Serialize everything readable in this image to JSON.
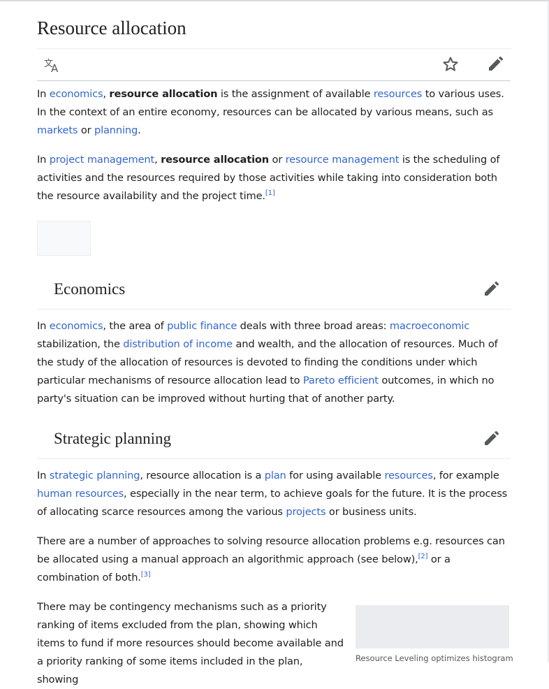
{
  "page": {
    "title": "Resource allocation",
    "actions": {
      "language_icon": "language-icon",
      "watch_icon": "star-icon",
      "edit_icon": "pencil-icon"
    }
  },
  "intro": {
    "p1": {
      "t1": "In ",
      "l1": "economics",
      "t2": ", ",
      "b1": "resource allocation",
      "t3": " is the assignment of available ",
      "l2": "resources",
      "t4": " to various uses. In the context of an entire economy, resources can be allocated by various means, such as ",
      "l3": "markets",
      "t5": " or ",
      "l4": "planning",
      "t6": "."
    },
    "p2": {
      "t1": "In ",
      "l1": "project management",
      "t2": ", ",
      "b1": "resource allocation",
      "t3": " or ",
      "l2": "resource management",
      "t4": " is the scheduling of activities and the resources required by those activities while taking into consideration both the resource availability and the project time.",
      "ref1": "[1]"
    }
  },
  "sections": [
    {
      "heading": "Economics",
      "edit_icon": "pencil-icon",
      "p1": {
        "t1": "In ",
        "l1": "economics",
        "t2": ", the area of ",
        "l2": "public finance",
        "t3": " deals with three broad areas: ",
        "l3": "macroeconomic",
        "t4": " stabilization, the ",
        "l4": "distribution of income",
        "t5": " and wealth, and the allocation of resources. Much of the study of the allocation of resources is devoted to finding the conditions under which particular mechanisms of resource allocation lead to ",
        "l5": "Pareto efficient",
        "t6": " outcomes, in which no party's situation can be improved without hurting that of another party."
      }
    },
    {
      "heading": "Strategic planning",
      "edit_icon": "pencil-icon",
      "p1": {
        "t1": "In ",
        "l1": "strategic planning",
        "t2": ", resource allocation is a ",
        "l2": "plan",
        "t3": " for using available ",
        "l3": "resources",
        "t4": ", for example ",
        "l4": "human resources",
        "t5": ", especially in the near term, to achieve goals for the future. It is the process of allocating scarce resources among the various ",
        "l5": "projects",
        "t6": " or business units."
      },
      "p2": {
        "t1": "There are a number of approaches to solving resource allocation problems e.g. resources can be allocated using a manual approach an algorithmic approach (see below),",
        "ref2": "[2]",
        "t2": " or a combination of both.",
        "ref3": "[3]"
      },
      "p3": {
        "t1": "There may be contingency mechanisms such as a priority ranking of items excluded from the plan, showing which items to fund if more resources should become available and a priority ranking of some items included in the plan, showing"
      },
      "figure": {
        "caption": "Resource Leveling optimizes histogram"
      }
    }
  ]
}
